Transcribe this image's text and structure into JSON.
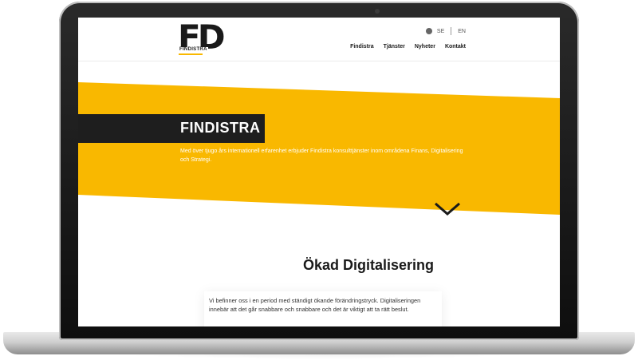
{
  "header": {
    "logo_letters": "FD",
    "logo_sub": "FINDISTRA",
    "lang": {
      "se": "SE",
      "en": "EN"
    },
    "nav": [
      "Findistra",
      "Tjänster",
      "Nyheter",
      "Kontakt"
    ]
  },
  "hero": {
    "title": "FINDISTRA",
    "text": "Med över tjugo års internationell erfarenhet erbjuder Findistra konsulttjänster inom områdena Finans, Digitalisering och Strategi."
  },
  "section": {
    "title": "Ökad Digitalisering",
    "body": "Vi befinner oss i en period med ständigt ökande förändringstryck. Digitaliseringen innebär att det går snabbare och snabbare och det är viktigt att ta rätt beslut."
  },
  "colors": {
    "accent": "#f9b800",
    "dark": "#1e1e1e"
  },
  "icons": {
    "globe": "globe-icon",
    "chevron": "chevron-down-icon"
  }
}
